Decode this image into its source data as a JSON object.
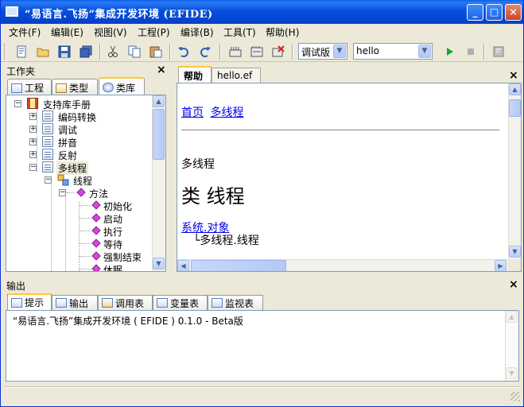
{
  "window": {
    "title": "“易语言.飞扬”集成开发环境 (EFIDE)"
  },
  "titlebar": {
    "minimize": "_",
    "maximize": "□",
    "close": "×"
  },
  "menu": [
    "文件(F)",
    "编辑(E)",
    "视图(V)",
    "工程(P)",
    "编译(B)",
    "工具(T)",
    "帮助(H)"
  ],
  "toolbar": {
    "config_combo": "调试版",
    "target_combo": "hello",
    "icons": [
      "new-file-icon",
      "open-folder-icon",
      "save-icon",
      "save-all-icon",
      "cut-icon",
      "copy-icon",
      "paste-icon",
      "undo-icon",
      "redo-icon",
      "compile-icon",
      "build-all-icon",
      "clean-icon",
      "run-icon",
      "stop-icon",
      "help-icon"
    ]
  },
  "workspace": {
    "header": "工作夹",
    "close": "×",
    "tabs": [
      "工程",
      "类型",
      "类库"
    ],
    "tree": {
      "root": "支持库手册",
      "items": [
        "编码转换",
        "调试",
        "拼音",
        "反射",
        "多线程"
      ],
      "class_node": "线程",
      "method_group": "方法",
      "methods": [
        "初始化",
        "启动",
        "执行",
        "等待",
        "强制结束",
        "休眠"
      ]
    }
  },
  "editor": {
    "tabs": [
      "帮助",
      "hello.ef"
    ],
    "close": "×",
    "doc": {
      "nav_home": "首页",
      "nav_current": "多线程",
      "section": "多线程",
      "heading": "类 线程",
      "parent_link": "系统.对象",
      "inherit_line": "└多线程.线程"
    }
  },
  "output": {
    "header": "输出",
    "close": "×",
    "tabs": [
      "提示",
      "输出",
      "调用表",
      "变量表",
      "监视表"
    ],
    "text": "“易语言.飞扬”集成开发环境 ( EFIDE ) 0.1.0 - Beta版"
  },
  "colors": {
    "title_blue": "#0550dc",
    "link": "#0000ee",
    "tab_accent": "#ffc83c"
  }
}
